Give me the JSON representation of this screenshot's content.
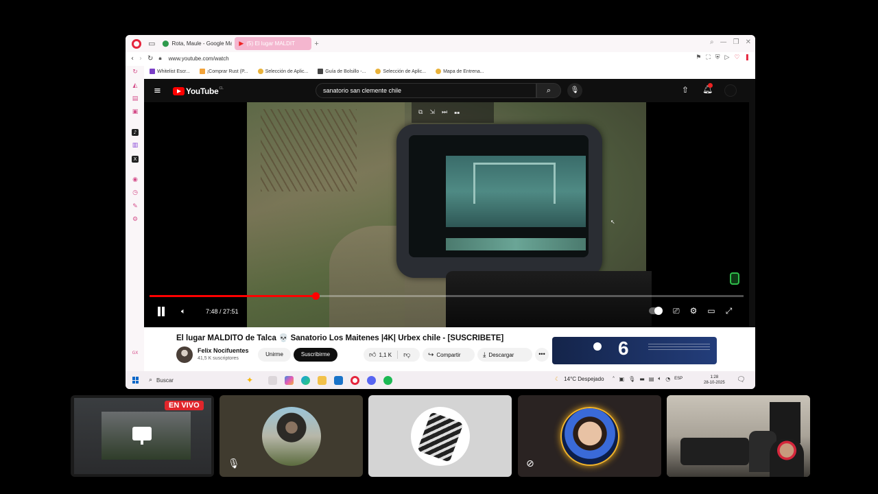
{
  "browser": {
    "tabs": [
      {
        "label": "Rota, Maule - Google Ma",
        "icon": "map-pin-icon",
        "active": false
      },
      {
        "label": "(5) El lugar MALDIT",
        "icon": "youtube-icon",
        "active": true
      }
    ],
    "url": "www.youtube.com/watch",
    "bookmarks": [
      {
        "label": "Whitelist Escr...",
        "color": "#7b3fc7"
      },
      {
        "label": "¡Comprar Rust (P...",
        "color": "#f2a33a"
      },
      {
        "label": "Selección de Aplic...",
        "color": "#e9b23a"
      },
      {
        "label": "Guía de Bolsillo -...",
        "color": "#444444"
      },
      {
        "label": "Selección de Aplic...",
        "color": "#e9b23a"
      },
      {
        "label": "Mapa de Entrena...",
        "color": "#e9b23a"
      }
    ]
  },
  "youtube": {
    "logo": "YouTube",
    "country_code": "CL",
    "search_query": "sanatorio san clemente chile",
    "notification_count": "9+",
    "player": {
      "time": "7:48 / 27:51",
      "progress": 0.28
    },
    "video_title": "El lugar MALDITO de Talca 💀 Sanatorio Los Maitenes |4K| Urbex chile - [SUSCRIBETE]",
    "channel_name": "Felix Nocifuentes",
    "channel_subs": "41,5 K suscriptores",
    "join_label": "Unirme",
    "subscribe_label": "Suscribirme",
    "like_count": "1,1 K",
    "share_label": "Compartir",
    "download_label": "Descargar",
    "more_label": "•••",
    "ad_number": "6"
  },
  "taskbar": {
    "search_label": "Buscar",
    "weather": "14°C Despejado",
    "language": "ESP",
    "time": "1:28",
    "date": "28-10-2025"
  },
  "call": {
    "live_label": "EN VIVO"
  }
}
